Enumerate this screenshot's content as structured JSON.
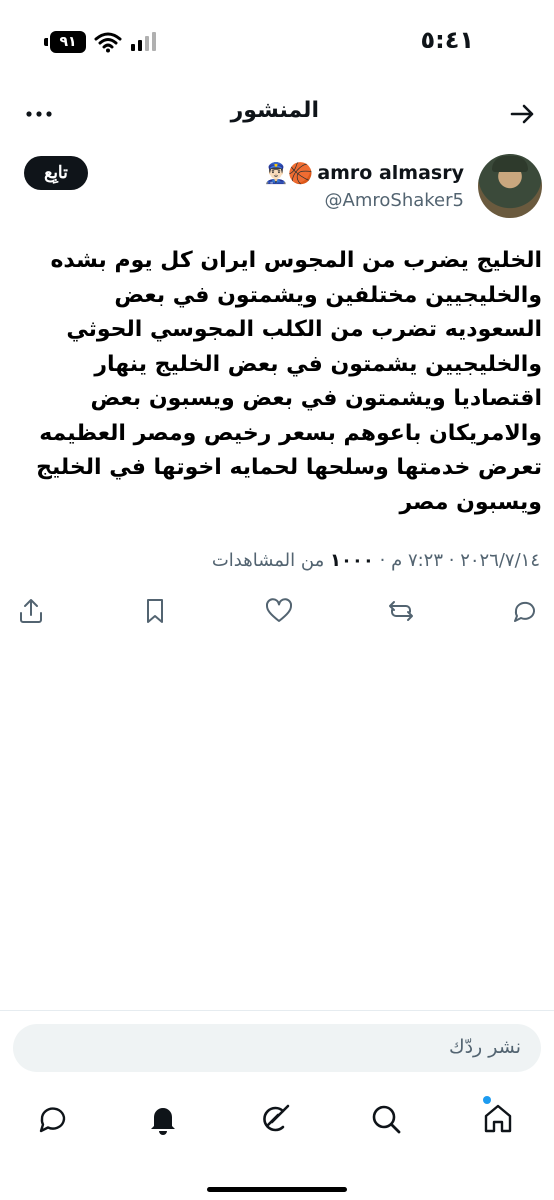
{
  "status_bar": {
    "time": "٥:٤١",
    "battery": "٩١"
  },
  "header": {
    "title": "المنشور"
  },
  "author": {
    "display_name": "amro almasry",
    "emojis": "👮🏻‍♂️🏀",
    "handle": "@AmroShaker5",
    "follow_label": "تابِع"
  },
  "tweet": {
    "lines": [
      "الخليج يضرب من  المجوس ايران كل يوم بشده",
      "والخليجيين مختلفين ويشمتون في بعض",
      "السعوديه تضرب من الكلب المجوسي الحوثي",
      "والخليجيين يشمتون في بعض الخليج ينهار",
      "اقتصاديا ويشمتون في بعض ويسبون بعض",
      "والامريكان باعوهم بسعر رخيص ومصر العظيمه",
      "تعرض خدمتها وسلحها لحمايه اخوتها في الخليج",
      "ويسبون مصر"
    ],
    "timestamp": "٢٠٢٦/٧/١٤ · ٧:٢٣ م · ",
    "views_count": "١٠٠٠",
    "views_label": "من المشاهدات"
  },
  "reply": {
    "placeholder": "نشر ردّك"
  },
  "colors": {
    "accent": "#1d9bf0",
    "text": "#0f1419",
    "muted": "#536471"
  },
  "icons": {
    "actions": [
      "reply-icon",
      "retweet-icon",
      "like-icon",
      "bookmark-icon",
      "share-icon"
    ],
    "nav": [
      "home-icon",
      "search-icon",
      "grok-icon",
      "notifications-icon",
      "messages-icon"
    ]
  }
}
